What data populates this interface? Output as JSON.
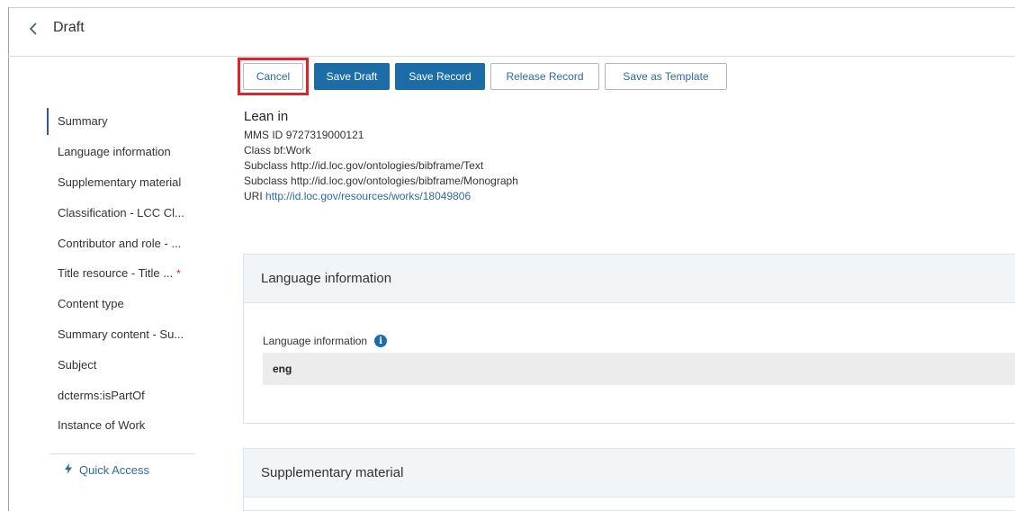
{
  "header": {
    "back_icon": "chevron-left-icon",
    "title": "Draft"
  },
  "toolbar": {
    "cancel_label": "Cancel",
    "save_draft_label": "Save Draft",
    "save_record_label": "Save Record",
    "release_record_label": "Release Record",
    "save_template_label": "Save as Template"
  },
  "sidebar": {
    "items": [
      {
        "label": "Summary",
        "active": true
      },
      {
        "label": "Language information"
      },
      {
        "label": "Supplementary material"
      },
      {
        "label": "Classification - LCC Cl..."
      },
      {
        "label": "Contributor and role - ..."
      },
      {
        "label": "Title resource - Title ...",
        "required_mark": "*"
      },
      {
        "label": "Content type"
      },
      {
        "label": "Summary content - Su..."
      },
      {
        "label": "Subject"
      },
      {
        "label": "dcterms:isPartOf"
      },
      {
        "label": "Instance of Work"
      }
    ],
    "quick_access": "Quick Access"
  },
  "record": {
    "title": "Lean in",
    "mms_label": "MMS ID",
    "mms_value": "9727319000121",
    "class_label": "Class",
    "class_value": "bf:Work",
    "subclass1_label": "Subclass",
    "subclass1_value": "http://id.loc.gov/ontologies/bibframe/Text",
    "subclass2_label": "Subclass",
    "subclass2_value": "http://id.loc.gov/ontologies/bibframe/Monograph",
    "uri_label": "URI",
    "uri_value": "http://id.loc.gov/resources/works/18049806"
  },
  "sections": {
    "language": {
      "heading": "Language information",
      "field_label": "Language information",
      "field_value": "eng"
    },
    "supplementary": {
      "heading": "Supplementary material"
    }
  },
  "colors": {
    "primary": "#1c6ca8",
    "highlight": "#d9262c",
    "link": "#2e6a9e"
  }
}
